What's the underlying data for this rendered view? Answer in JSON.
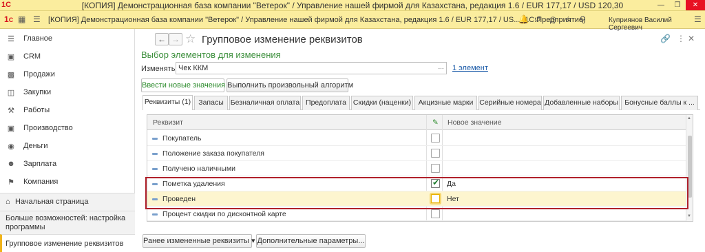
{
  "titlebar": {
    "logo": "1С",
    "title": "[КОПИЯ] Демонстрационная база компании \"Ветерок\" / Управление нашей фирмой для Казахстана, редакция 1.6 / EUR 177,17 / USD 120,30"
  },
  "appbar": {
    "title": "[КОПИЯ] Демонстрационная база компании \"Ветерок\" / Управление нашей фирмой для Казахстана, редакция 1.6 / EUR 177,17 / US...  (1С:Предприятие)",
    "user": "Куприянов Василий Сергеевич"
  },
  "sidebar": {
    "items": [
      {
        "label": "Главное",
        "icon": "menu-icon"
      },
      {
        "label": "CRM",
        "icon": "crm-icon"
      },
      {
        "label": "Продажи",
        "icon": "sales-icon"
      },
      {
        "label": "Закупки",
        "icon": "purchases-icon"
      },
      {
        "label": "Работы",
        "icon": "works-icon"
      },
      {
        "label": "Производство",
        "icon": "production-icon"
      },
      {
        "label": "Деньги",
        "icon": "money-icon"
      },
      {
        "label": "Зарплата",
        "icon": "salary-icon"
      },
      {
        "label": "Компания",
        "icon": "company-icon"
      }
    ],
    "home": "Начальная страница",
    "more": "Больше возможностей: настройка программы",
    "current": "Групповое изменение реквизитов"
  },
  "form": {
    "title": "Групповое изменение реквизитов",
    "subheader": "Выбор элементов для изменения",
    "change_label": "Изменять:",
    "change_value": "Чек ККМ",
    "elements_link": "1 элемент",
    "btn_new_values": "Ввести новые значения",
    "btn_algorithm": "Выполнить произвольный алгоритм",
    "tabs": [
      "Реквизиты (1)",
      "Запасы",
      "Безналичная оплата",
      "Предоплата",
      "Скидки (наценки)",
      "Акцизные марки",
      "Серийные номера",
      "Добавленные наборы",
      "Бонусные баллы к ..."
    ],
    "table": {
      "col_attr": "Реквизит",
      "col_new": "Новое значение",
      "rows": [
        {
          "name": "Покупатель",
          "checked": false,
          "value": ""
        },
        {
          "name": "Положение заказа покупателя",
          "checked": false,
          "value": ""
        },
        {
          "name": "Получено наличными",
          "checked": false,
          "value": ""
        },
        {
          "name": "Пометка удаления",
          "checked": true,
          "value": "Да"
        },
        {
          "name": "Проведен",
          "checked": false,
          "value": "Нет"
        },
        {
          "name": "Процент скидки по дисконтной карте",
          "checked": false,
          "value": ""
        }
      ]
    },
    "btn_prev": "Ранее измененные реквизиты",
    "btn_extra": "Дополнительные параметры..."
  }
}
